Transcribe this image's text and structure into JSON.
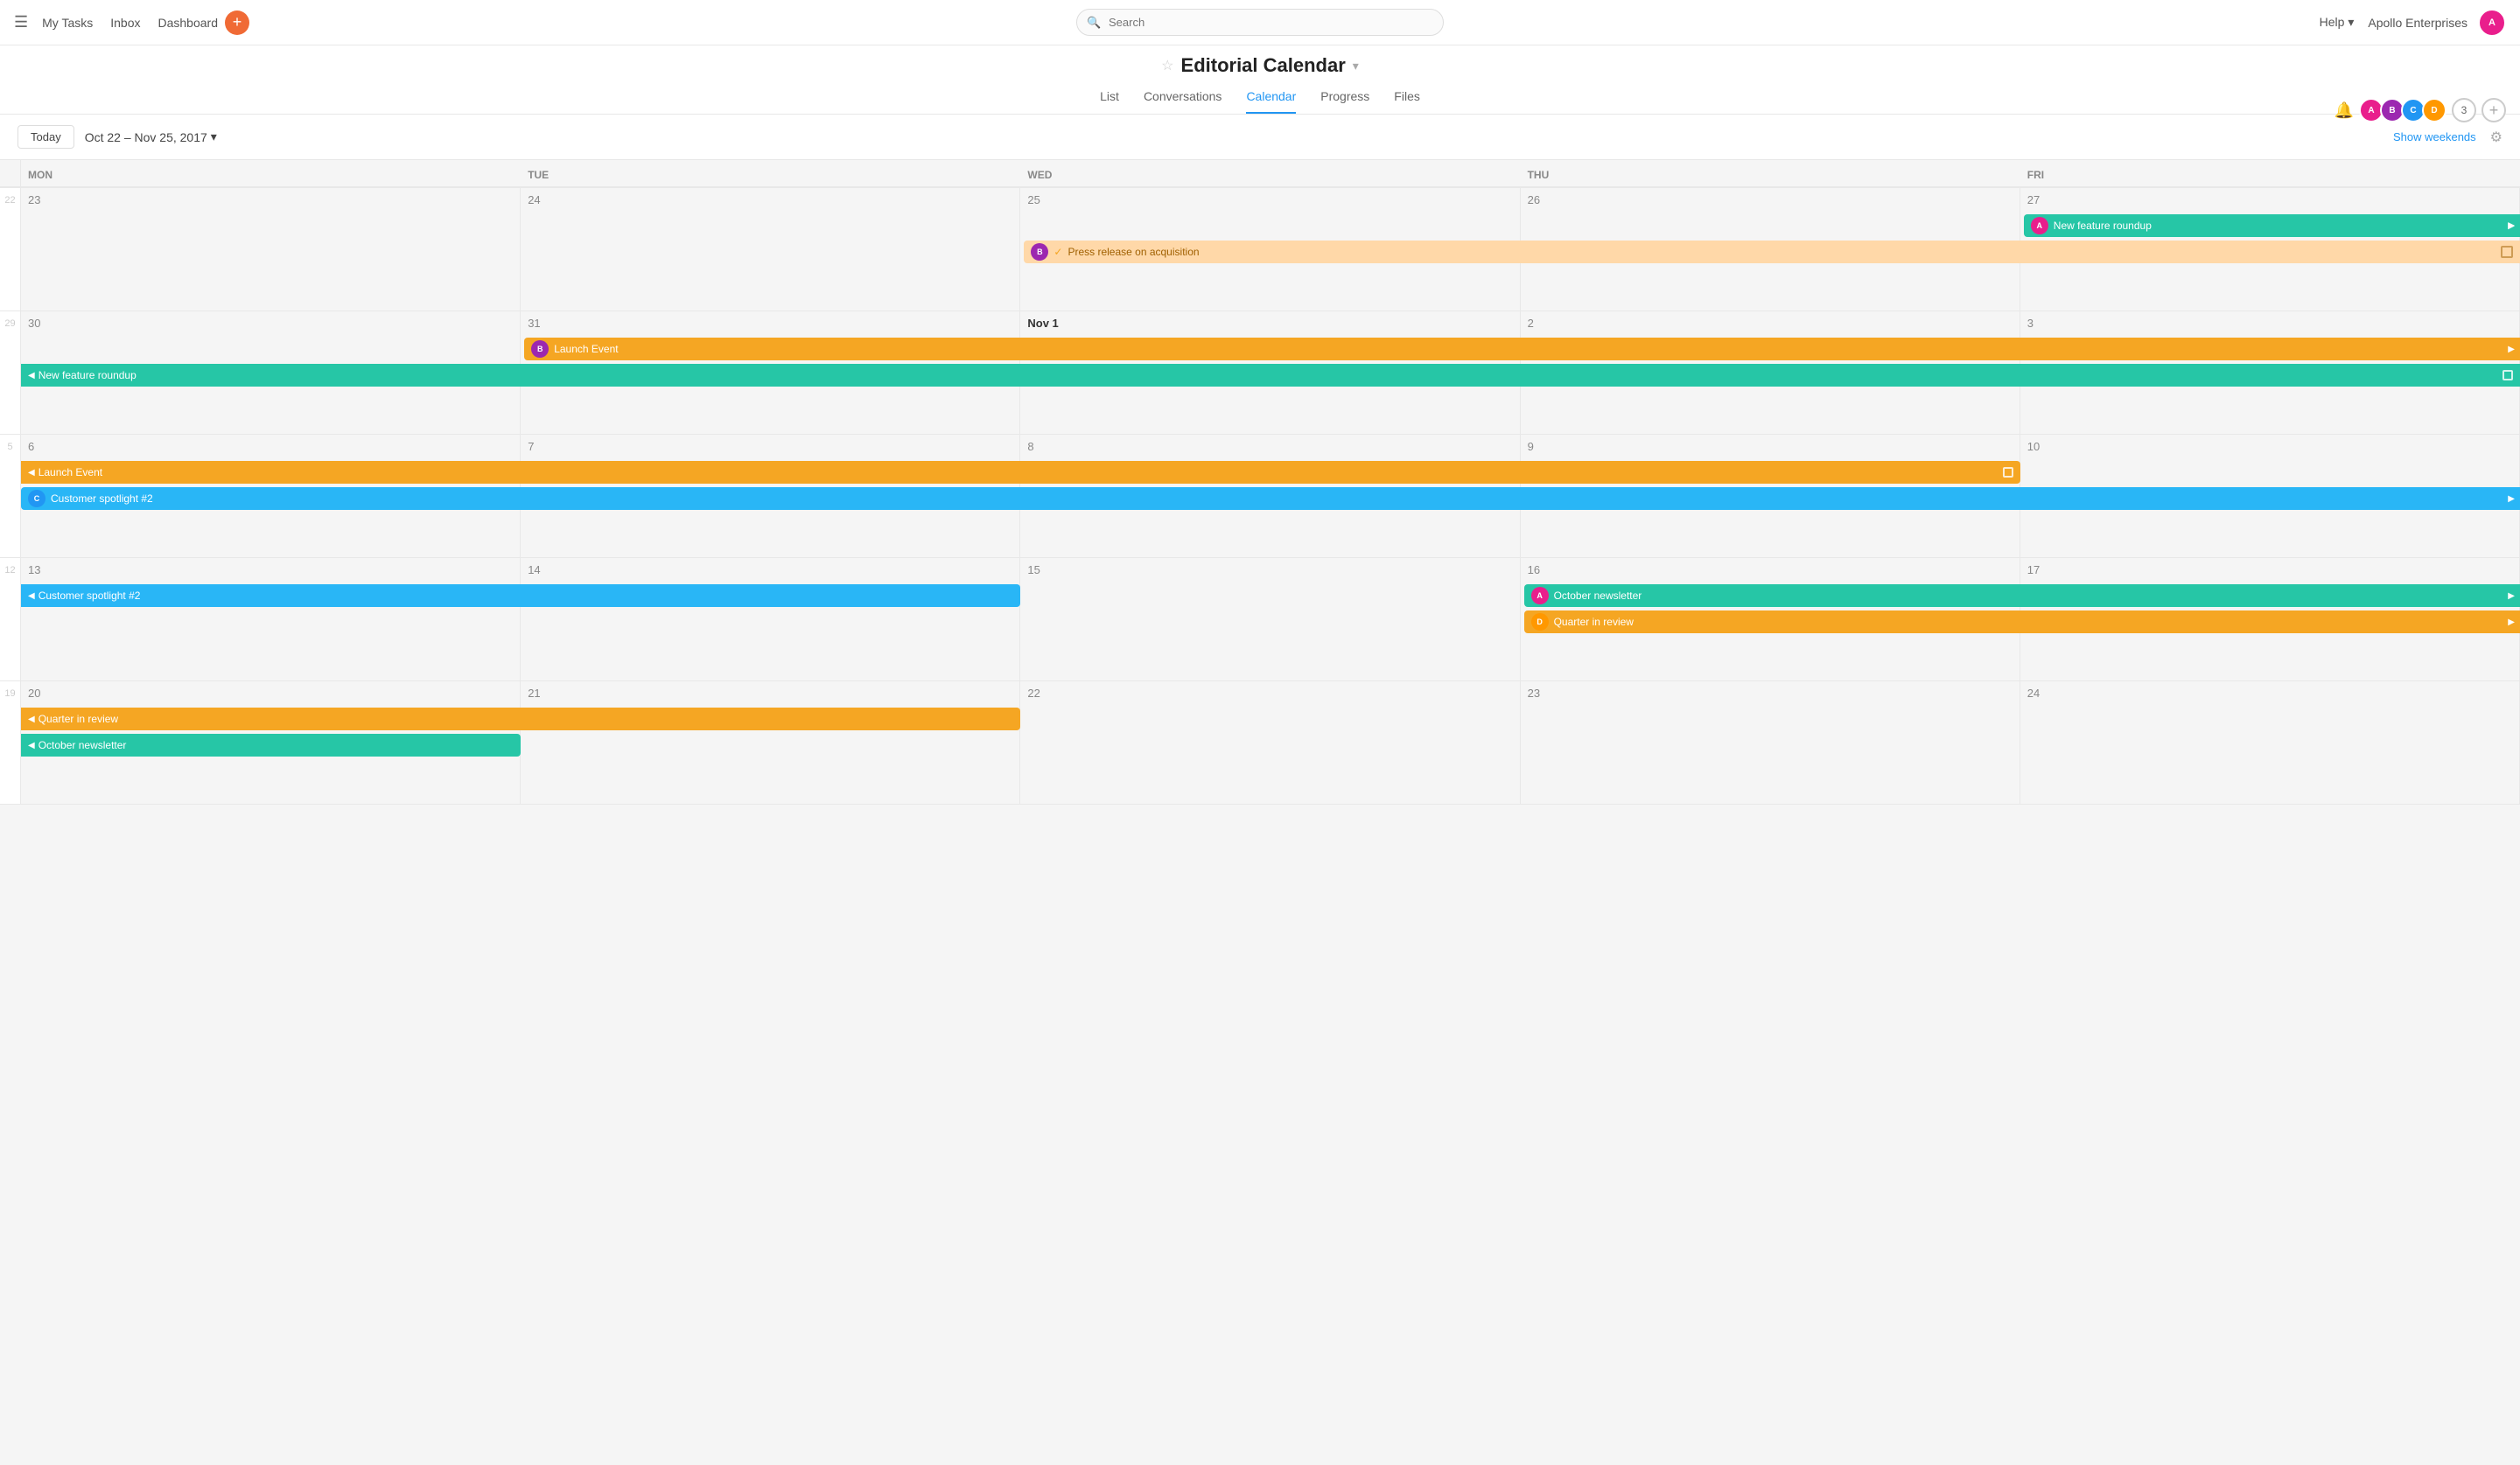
{
  "nav": {
    "hamburger": "☰",
    "my_tasks": "My Tasks",
    "inbox": "Inbox",
    "dashboard": "Dashboard",
    "search_placeholder": "Search",
    "help": "Help",
    "org": "Apollo Enterprises"
  },
  "project": {
    "title": "Editorial Calendar",
    "tabs": [
      "List",
      "Conversations",
      "Calendar",
      "Progress",
      "Files"
    ],
    "active_tab": "Calendar"
  },
  "calendar": {
    "today_btn": "Today",
    "date_range": "Oct 22 – Nov 25, 2017",
    "show_weekends": "Show weekends",
    "headers": [
      "MON",
      "TUE",
      "WED",
      "THU",
      "FRI"
    ],
    "weeks": [
      {
        "week_num": "22",
        "days": [
          {
            "num": "23",
            "label": "23"
          },
          {
            "num": "24",
            "label": "24"
          },
          {
            "num": "25",
            "label": "25"
          },
          {
            "num": "26",
            "label": "26"
          },
          {
            "num": "27",
            "label": "27"
          }
        ]
      }
    ]
  },
  "events": {
    "new_feature_roundup": "New feature roundup",
    "press_release": "Press release on acquisition",
    "launch_event": "Launch Event",
    "customer_spotlight": "Customer spotlight #2",
    "october_newsletter": "October newsletter",
    "quarter_in_review": "Quarter in review"
  },
  "avatars": {
    "user1_bg": "#e91e8c",
    "user2_bg": "#9c27b0",
    "user3_bg": "#2196f3",
    "user4_bg": "#ff9800",
    "user5_bg": "#f44336"
  }
}
